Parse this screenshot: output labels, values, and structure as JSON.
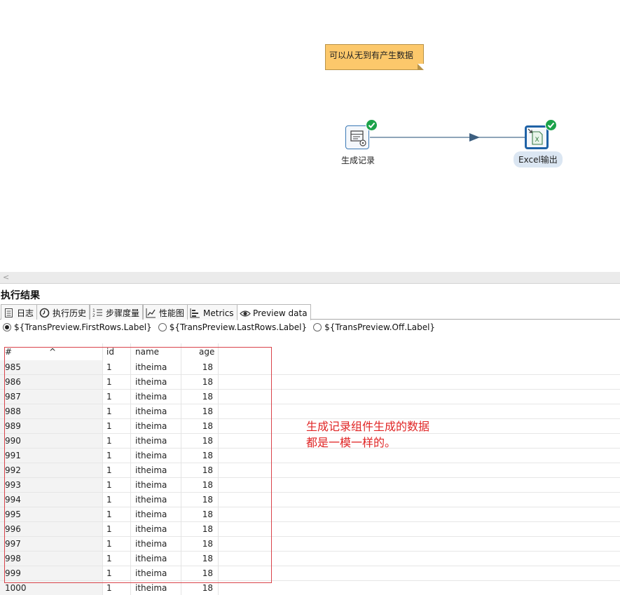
{
  "canvas": {
    "note_text": "可以从无到有产生数据",
    "steps": {
      "generate": {
        "label": "生成记录",
        "icon": "generate-rows-icon",
        "status_icon": "check-icon"
      },
      "excel": {
        "label": "Excel输出",
        "icon": "excel-output-icon",
        "status_icon": "check-icon"
      }
    },
    "colors": {
      "note": "#fcc86b",
      "ok": "#1ba24a",
      "hop": "#4a6f8f"
    }
  },
  "results": {
    "title": "执行结果",
    "tabs": [
      {
        "label": "日志",
        "icon": "log-icon"
      },
      {
        "label": "执行历史",
        "icon": "history-icon"
      },
      {
        "label": "步骤度量",
        "icon": "step-metrics-icon"
      },
      {
        "label": "性能图",
        "icon": "performance-chart-icon"
      },
      {
        "label": "Metrics",
        "icon": "metrics-icon"
      },
      {
        "label": "Preview data",
        "icon": "eye-icon"
      }
    ],
    "radios": [
      {
        "label": "${TransPreview.FirstRows.Label}",
        "checked": true
      },
      {
        "label": "${TransPreview.LastRows.Label}",
        "checked": false
      },
      {
        "label": "${TransPreview.Off.Label}",
        "checked": false
      }
    ],
    "table": {
      "columns": [
        "#",
        "id",
        "name",
        "age"
      ],
      "rows": [
        [
          "985",
          "1",
          "itheima",
          "18"
        ],
        [
          "986",
          "1",
          "itheima",
          "18"
        ],
        [
          "987",
          "1",
          "itheima",
          "18"
        ],
        [
          "988",
          "1",
          "itheima",
          "18"
        ],
        [
          "989",
          "1",
          "itheima",
          "18"
        ],
        [
          "990",
          "1",
          "itheima",
          "18"
        ],
        [
          "991",
          "1",
          "itheima",
          "18"
        ],
        [
          "992",
          "1",
          "itheima",
          "18"
        ],
        [
          "993",
          "1",
          "itheima",
          "18"
        ],
        [
          "994",
          "1",
          "itheima",
          "18"
        ],
        [
          "995",
          "1",
          "itheima",
          "18"
        ],
        [
          "996",
          "1",
          "itheima",
          "18"
        ],
        [
          "997",
          "1",
          "itheima",
          "18"
        ],
        [
          "998",
          "1",
          "itheima",
          "18"
        ],
        [
          "999",
          "1",
          "itheima",
          "18"
        ],
        [
          "1000",
          "1",
          "itheima",
          "18"
        ]
      ]
    },
    "annotation": {
      "line1": "生成记录组件生成的数据",
      "line2": "都是一模一样的。",
      "color": "#e02525"
    }
  }
}
